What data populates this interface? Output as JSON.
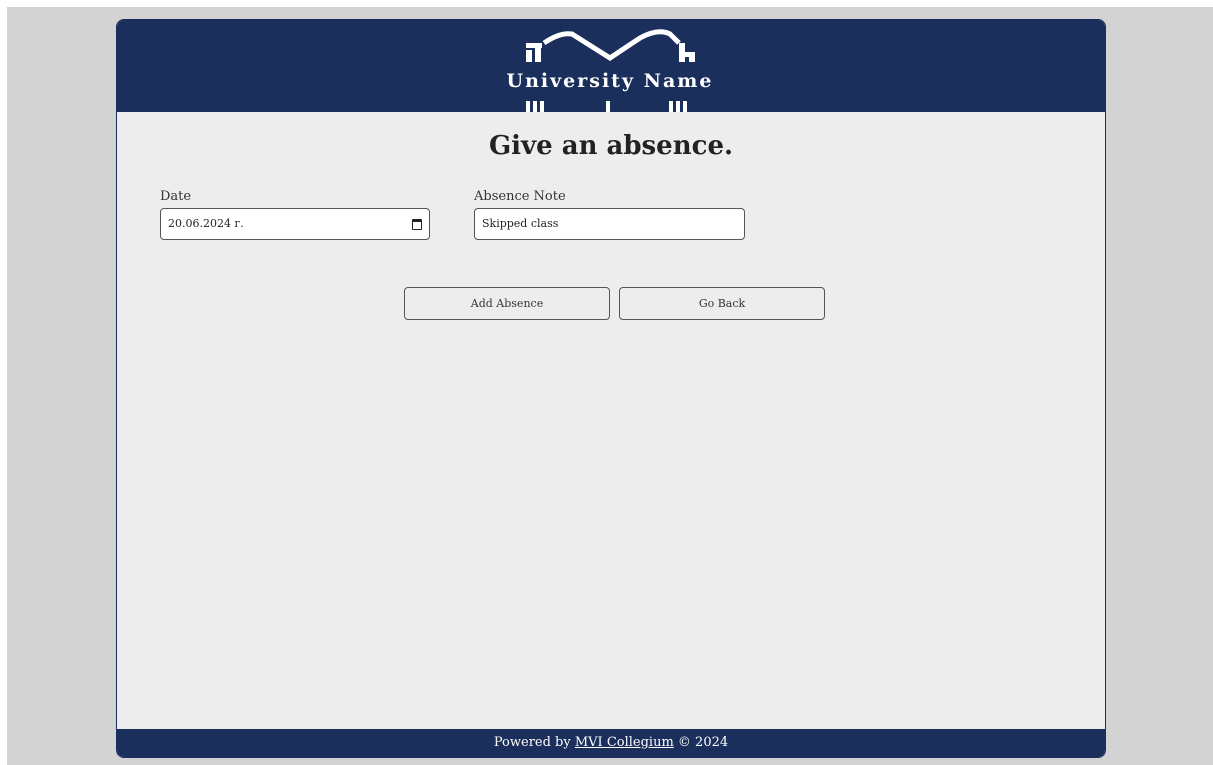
{
  "logo": {
    "text": "University Name"
  },
  "form": {
    "title": "Give an absence.",
    "date_label": "Date",
    "date_value": "20.06.2024 г.",
    "note_label": "Absence Note",
    "note_value": "Skipped class"
  },
  "buttons": {
    "add": "Add Absence",
    "back": "Go Back"
  },
  "footer": {
    "prefix": "Powered by ",
    "link": "MVI Collegium",
    "suffix": " © 2024"
  },
  "colors": {
    "brand": "#1b2f5c",
    "card_bg": "#ededed",
    "page_bg": "#d3d3d3"
  }
}
